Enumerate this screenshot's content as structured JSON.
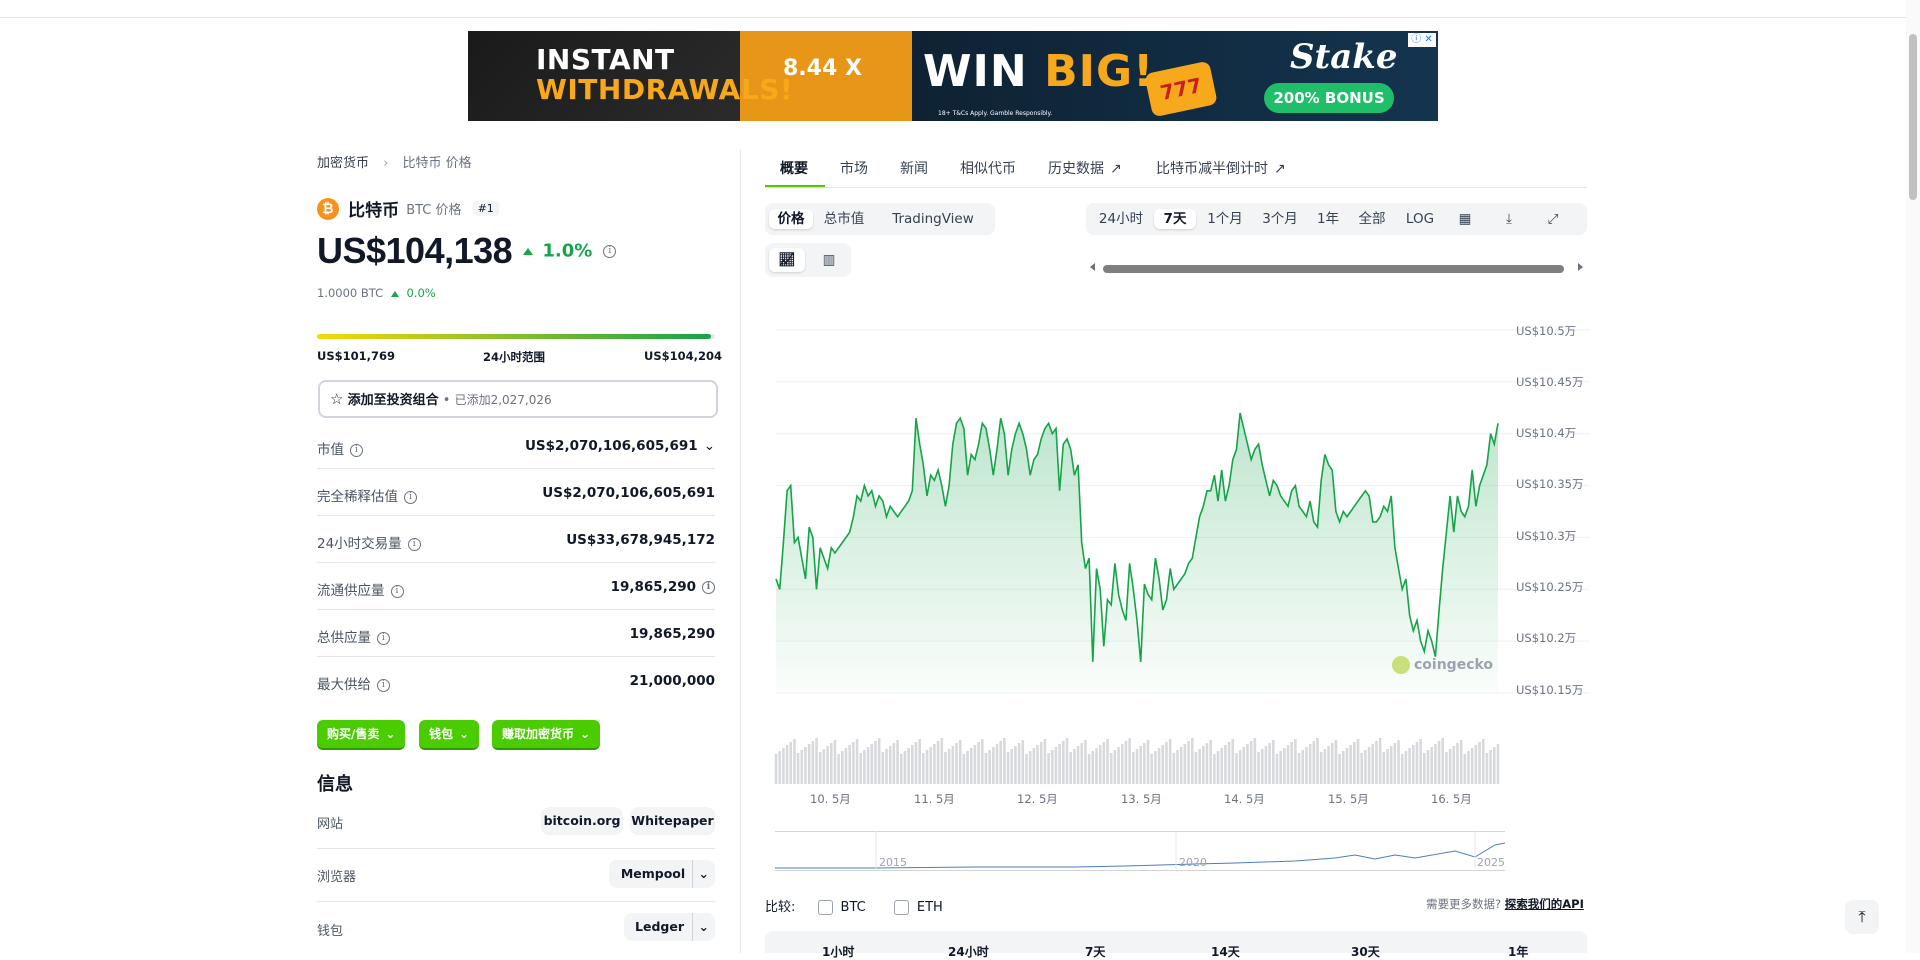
{
  "ad": {
    "line1": "INSTANT",
    "line2": "WITHDRAWALS!",
    "multiplier": "8.44 X",
    "win_a": "WIN",
    "win_b": "BIG!",
    "slot": "777",
    "brand": "Stake",
    "bonus": "200% BONUS",
    "fine": "18+ T&Cs Apply. Gamble Responsibly.",
    "close": "ⓘ ✕"
  },
  "breadcrumb": {
    "root": "加密货币",
    "current": "比特币 价格"
  },
  "coin": {
    "name": "比特币",
    "symbol_label": "BTC 价格",
    "rank": "#1",
    "price": "US$104,138",
    "change": "1.0%",
    "btc_amount": "1.0000 BTC",
    "btc_change": "0.0%",
    "range_low": "US$101,769",
    "range_label": "24小时范围",
    "range_high": "US$104,204",
    "range_fill": 0.99
  },
  "portfolio": {
    "label": "添加至投资组合",
    "sep": "•",
    "count": "已添加2,027,026"
  },
  "stats": [
    {
      "key": "市值",
      "value": "US$2,070,106,605,691"
    },
    {
      "key": "完全稀释估值",
      "value": "US$2,070,106,605,691"
    },
    {
      "key": "24小时交易量",
      "value": "US$33,678,945,172"
    },
    {
      "key": "流通供应量",
      "value": "19,865,290"
    },
    {
      "key": "总供应量",
      "value": "19,865,290"
    },
    {
      "key": "最大供给",
      "value": "21,000,000"
    }
  ],
  "actions": {
    "buy": "购买/售卖",
    "wallet": "钱包",
    "earn": "赚取加密货币"
  },
  "info": {
    "title": "信息",
    "website_label": "网站",
    "website_links": [
      "bitcoin.org",
      "Whitepaper"
    ],
    "explorer_label": "浏览器",
    "explorer_value": "Mempool",
    "wallet_label": "钱包",
    "wallet_value": "Ledger"
  },
  "tabs": [
    "概要",
    "市场",
    "新闻",
    "相似代币",
    "历史数据",
    "比特币减半倒计时"
  ],
  "chart_controls": {
    "metric_tabs": [
      "价格",
      "总市值",
      "TradingView"
    ],
    "range_tabs": [
      "24小时",
      "7天",
      "1个月",
      "3个月",
      "1年",
      "全部",
      "LOG"
    ],
    "selected_range": "7天"
  },
  "watermark": "coingecko",
  "compare": {
    "label": "比较:",
    "options": [
      "BTC",
      "ETH"
    ],
    "more": "需要更多数据?",
    "api_link": "探索我们的API"
  },
  "bottom_tabs": [
    "1小时",
    "24小时",
    "7天",
    "14天",
    "30天",
    "1年"
  ],
  "chart_data": {
    "type": "area",
    "title": "",
    "xlabel": "",
    "ylabel": "",
    "x_ticks": [
      "10. 5月",
      "11. 5月",
      "12. 5月",
      "13. 5月",
      "14. 5月",
      "15. 5月",
      "16. 5月"
    ],
    "y_ticks": [
      "US$10.5万",
      "US$10.45万",
      "US$10.4万",
      "US$10.35万",
      "US$10.3万",
      "US$10.25万",
      "US$10.2万",
      "US$10.15万"
    ],
    "ylim": [
      101500,
      105000
    ],
    "series": [
      {
        "values": [
          102600,
          102500,
          102950,
          103450,
          103500,
          102950,
          103000,
          102800,
          102600,
          103100,
          103000,
          102500,
          102900,
          102800,
          102700,
          102900,
          102850,
          102900,
          102950,
          103000,
          103050,
          103200,
          103400,
          103350,
          103500,
          103400,
          103450,
          103300,
          103400,
          103350,
          103200,
          103300,
          103250,
          103200,
          103250,
          103300,
          103350,
          103450,
          104150,
          103900,
          103700,
          103400,
          103600,
          103550,
          103650,
          103500,
          103300,
          103500,
          103900,
          104100,
          104150,
          104050,
          103600,
          103800,
          103750,
          103900,
          104100,
          104050,
          103850,
          103600,
          103850,
          104150,
          104000,
          103600,
          103850,
          104000,
          104100,
          104000,
          103850,
          103600,
          103750,
          103800,
          103950,
          104050,
          104100,
          104000,
          104050,
          103450,
          103900,
          103950,
          103850,
          103600,
          103700,
          102950,
          102700,
          102800,
          101800,
          102700,
          102500,
          101950,
          102400,
          102350,
          102750,
          102450,
          102300,
          102200,
          102750,
          102500,
          102200,
          101800,
          102550,
          102450,
          102400,
          102800,
          102600,
          102300,
          102400,
          102700,
          102500,
          102550,
          102600,
          102650,
          102750,
          102800,
          103000,
          103200,
          103300,
          103450,
          103450,
          103600,
          103350,
          103650,
          103350,
          103500,
          103750,
          103850,
          104200,
          104050,
          103900,
          103750,
          103850,
          103900,
          103700,
          103550,
          103400,
          103550,
          103500,
          103400,
          103350,
          103300,
          103450,
          103500,
          103300,
          103250,
          103200,
          103350,
          103150,
          103100,
          103550,
          103800,
          103700,
          103650,
          103250,
          103150,
          103250,
          103200,
          103250,
          103300,
          103350,
          103400,
          103450,
          103400,
          103150,
          103150,
          103200,
          103300,
          103250,
          103400,
          102900,
          102700,
          102500,
          102600,
          102250,
          102100,
          102200,
          102000,
          101900,
          102100,
          102000,
          101850,
          102300,
          102700,
          103050,
          103400,
          103050,
          103400,
          103250,
          103200,
          103300,
          103650,
          103300,
          103500,
          103600,
          103700,
          104000,
          103900,
          104100
        ]
      }
    ]
  }
}
